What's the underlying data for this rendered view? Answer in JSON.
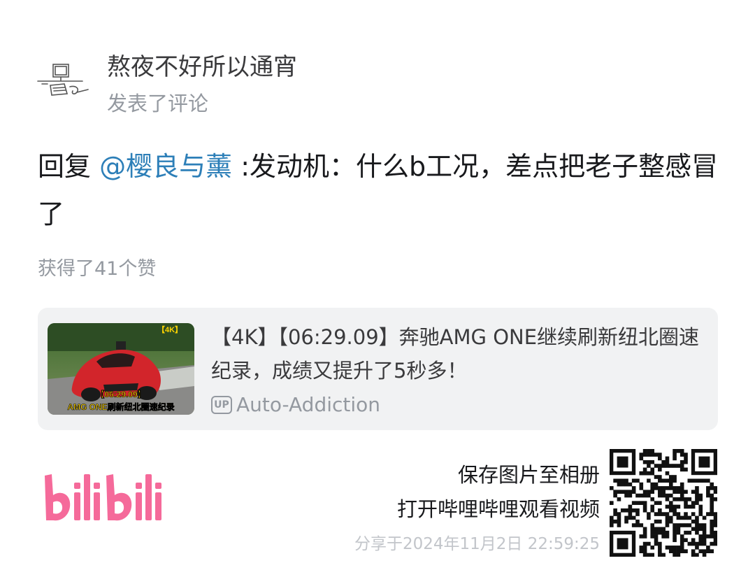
{
  "header": {
    "avatar_icon": "computer-sketch-avatar",
    "username": "熬夜不好所以通宵",
    "action": "发表了评论"
  },
  "comment": {
    "prefix": "回复 ",
    "mention": "@樱良与薰",
    "body": " :发动机：什么b工况，差点把老子整感冒了",
    "likes": "获得了41个赞"
  },
  "video_card": {
    "thumbnail": {
      "badge": "【4K】",
      "time_caption": "【06:29.09】",
      "caption": "AMG ONE刷新纽北圈速纪录"
    },
    "title": "【4K】【06:29.09】奔驰AMG ONE继续刷新纽北圈速纪录，成绩又提升了5秒多！",
    "up_badge": "UP",
    "up_name": "Auto-Addiction"
  },
  "footer": {
    "logo_text": "bilibili",
    "save_text": "保存图片至相册",
    "open_text": "打开哔哩哔哩观看视频",
    "share_time": "分享于2024年11月2日 22:59:25"
  },
  "colors": {
    "mention": "#2d7fb8",
    "brand_pink": "#f56a9a",
    "card_bg": "#f1f2f3",
    "secondary_text": "#9499a0"
  }
}
